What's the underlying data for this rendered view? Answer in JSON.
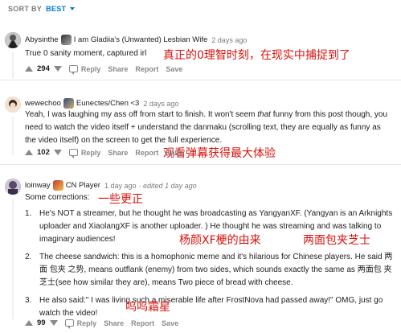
{
  "sort": {
    "label": "SORT BY",
    "value": "BEST"
  },
  "comments": [
    {
      "username": "Abysinthe",
      "flair": "I am Gladiia's (Unwanted) Lesbian Wife",
      "time": "2 days ago",
      "body": "True 0 sanity moment, captured irl",
      "score": "294",
      "annotation": "真正的0理智时刻，在现实中捕捉到了"
    },
    {
      "username": "wewechoo",
      "flair": "Eunectes/Chen <3",
      "time": "2 days ago",
      "body_parts": [
        "Yeah, I was laughing my ass off from start to finish. It won't seem ",
        "that",
        " funny from this post though, you need to watch the video itself + understand the danmaku (scrolling text, they are equally as funny as the video itself) on the screen to get the full experience."
      ],
      "score": "102",
      "annotation": "观看弹幕获得最大体验"
    },
    {
      "username": "loinway",
      "flair": "CN Player",
      "time": "1 day ago",
      "edited": "· edited 1 day ago",
      "intro": "Some corrections:",
      "intro_annotation": "一些更正",
      "items": [
        {
          "num": "1.",
          "text": "He's NOT a streamer, but he thought he was broadcasting as YangyanXF. (Yangyan is an Arknights uploader and XiaolangXF is another uploader. ) He thought he was streaming and was talking to imaginary audiences!"
        },
        {
          "num": "2.",
          "text": "The cheese sandwich: this is a homophonic meme and it's hilarious for Chinese players. He said 两面 包夹 之势, means outflank (enemy) from two sides, which sounds exactly the same as 两面包 夹 芝士(see how similar they are), means Two piece of bread with cheese."
        },
        {
          "num": "3.",
          "text": "He also said:\" I was living such a miserable life after FrostNova had passed away!\" OMG, just go watch the video!"
        }
      ],
      "annotations": [
        "杨颜XF梗的由来",
        "两面包夹芝士",
        "呜呜霜星"
      ],
      "score": "99"
    }
  ],
  "actions": {
    "reply": "Reply",
    "share": "Share",
    "report": "Report",
    "save": "Save"
  },
  "colors": {
    "accent": "#0079d3",
    "annotation": "#d8120c",
    "muted": "#878a8c"
  }
}
